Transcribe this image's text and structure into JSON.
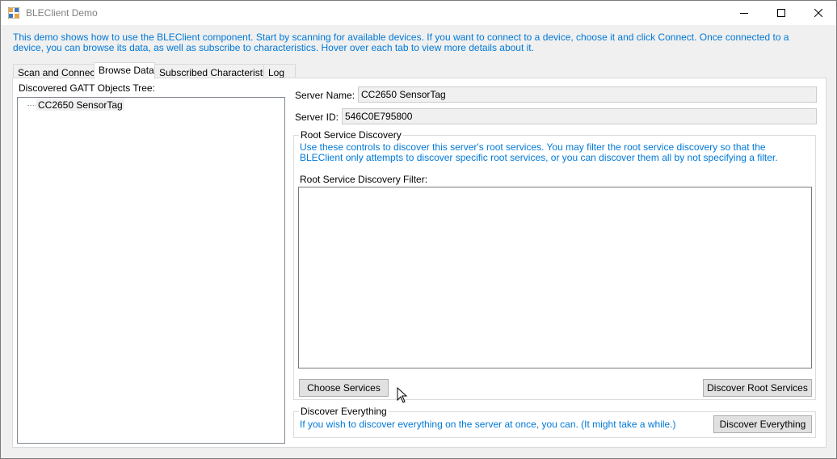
{
  "window": {
    "title": "BLEClient Demo"
  },
  "intro": "This demo shows how to use the BLEClient component. Start by scanning for available devices. If you want to connect to a device, choose it and click Connect. Once connected to a device, you can browse its data, as well as subscribe to characteristics. Hover over each tab to view more details about it.",
  "tabs": [
    {
      "label": "Scan and Connect"
    },
    {
      "label": "Browse Data"
    },
    {
      "label": "Subscribed Characteristics"
    },
    {
      "label": "Log"
    }
  ],
  "tree": {
    "label": "Discovered GATT Objects Tree:",
    "nodes": [
      {
        "label": "CC2650 SensorTag"
      }
    ]
  },
  "server": {
    "name_label": "Server Name:",
    "name_value": "CC2650 SensorTag",
    "id_label": "Server ID:",
    "id_value": "546C0E795800"
  },
  "root_discovery": {
    "title": "Root Service Discovery",
    "description": "Use these controls to discover this server's root services. You may filter the root service discovery so that the BLEClient only attempts to discover specific root services, or you can discover them all by not specifying a filter.",
    "filter_label": "Root Service Discovery Filter:",
    "filter_value": "",
    "choose_button": "Choose Services",
    "discover_button": "Discover Root Services"
  },
  "discover_everything": {
    "title": "Discover Everything",
    "description": "If you wish to discover everything on the server at once, you can. (It might take a while.)",
    "button": "Discover Everything"
  },
  "colors": {
    "accent_text": "#0078d7",
    "title_text": "#808080"
  },
  "icons": [
    "app-icon",
    "minimize-icon",
    "maximize-icon",
    "close-icon",
    "mouse-cursor-icon"
  ]
}
